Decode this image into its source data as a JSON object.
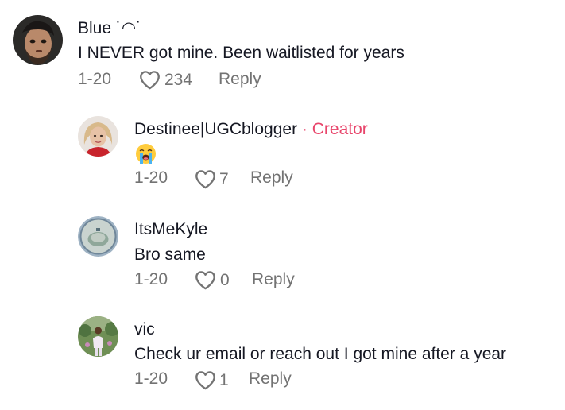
{
  "comments": [
    {
      "username": "Blue ˙◠˙",
      "text": "I NEVER got mine. Been waitlisted for years",
      "date": "1-20",
      "likes": "234",
      "reply_label": "Reply"
    },
    {
      "username": "Destinee|UGCblogger",
      "creator_badge": "· Creator",
      "text": "😭",
      "date": "1-20",
      "likes": "7",
      "reply_label": "Reply"
    },
    {
      "username": "ItsMeKyle",
      "text": "Bro same",
      "date": "1-20",
      "likes": "0",
      "reply_label": "Reply"
    },
    {
      "username": "vic",
      "text": "Check ur email or reach out I got mine after a year",
      "date": "1-20",
      "likes": "1",
      "reply_label": "Reply"
    }
  ],
  "colors": {
    "creator_accent": "#e8456b",
    "meta_text": "#737373",
    "primary_text": "#161823"
  },
  "icons": {
    "like": "heart-outline-icon",
    "emoji": "loudly-crying-face-emoji"
  }
}
